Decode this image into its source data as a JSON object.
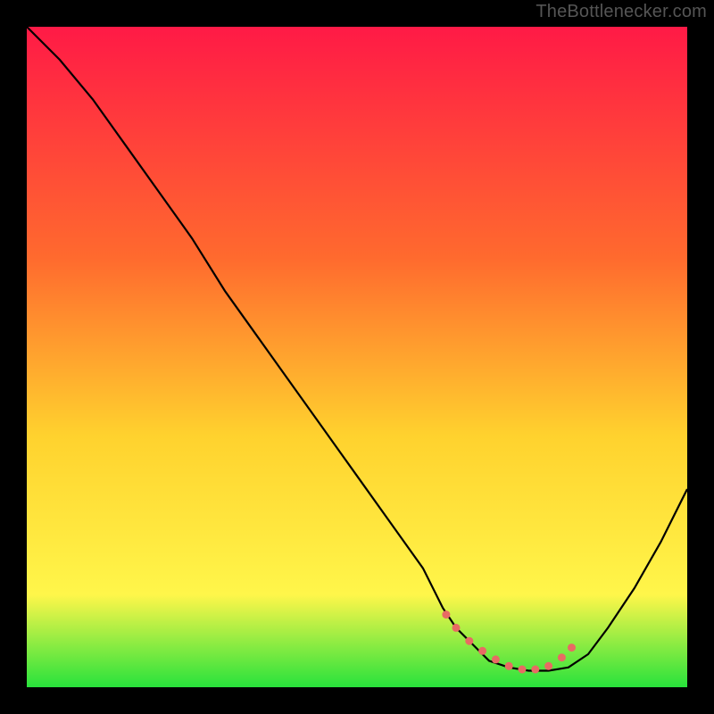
{
  "watermark": "TheBottlenecker.com",
  "colors": {
    "frame": "#000000",
    "grad_top": "#ff1a46",
    "grad_mid1": "#ff6a2e",
    "grad_mid2": "#ffd22e",
    "grad_mid3": "#fff64a",
    "grad_bottom": "#28e23c",
    "curve": "#000000",
    "marker": "#e86b63",
    "watermark": "#555555"
  },
  "chart_data": {
    "type": "line",
    "title": "",
    "xlabel": "",
    "ylabel": "",
    "xlim": [
      0,
      100
    ],
    "ylim": [
      0,
      100
    ],
    "x": [
      0,
      5,
      10,
      15,
      20,
      25,
      30,
      35,
      40,
      45,
      50,
      55,
      60,
      63,
      65,
      68,
      70,
      73,
      76,
      79,
      82,
      85,
      88,
      92,
      96,
      100
    ],
    "values": [
      100,
      95,
      89,
      82,
      75,
      68,
      60,
      53,
      46,
      39,
      32,
      25,
      18,
      12,
      9,
      6,
      4,
      3,
      2.5,
      2.5,
      3,
      5,
      9,
      15,
      22,
      30
    ],
    "markers_x": [
      63.5,
      65,
      67,
      69,
      71,
      73,
      75,
      77,
      79,
      81,
      82.5
    ],
    "markers_y": [
      11,
      9,
      7,
      5.5,
      4.2,
      3.2,
      2.7,
      2.7,
      3.2,
      4.5,
      6
    ],
    "annotations": []
  }
}
